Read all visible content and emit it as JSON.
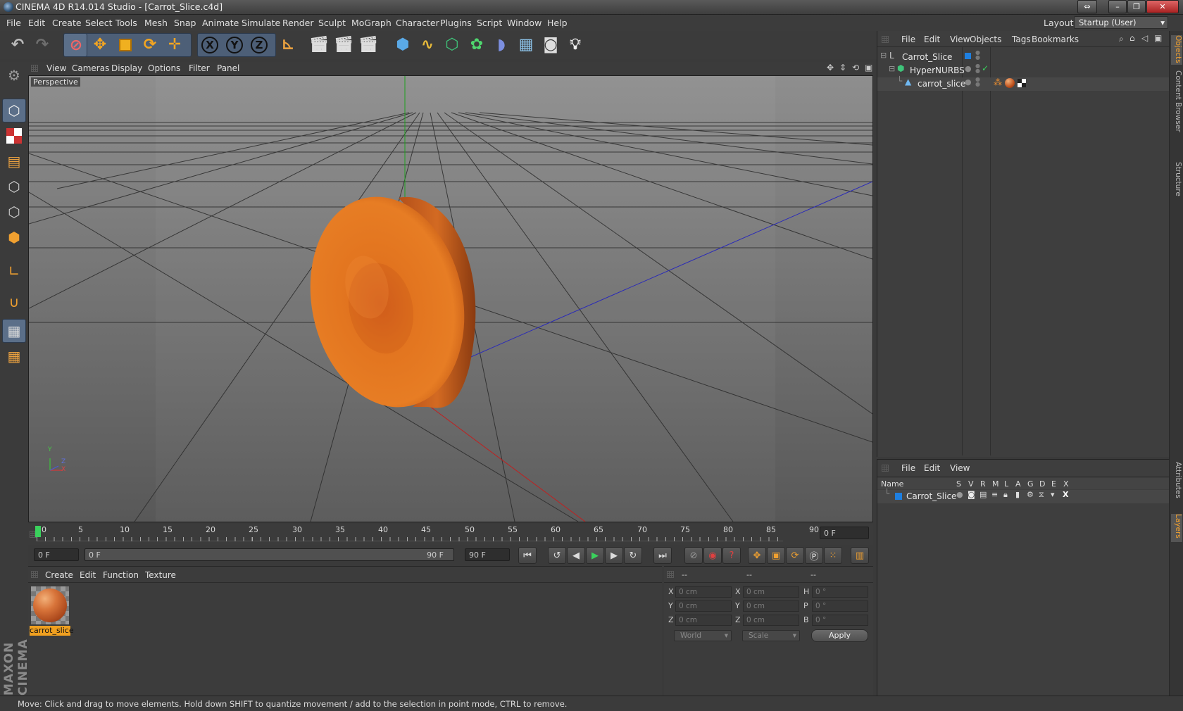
{
  "window": {
    "title": "CINEMA 4D R14.014 Studio - [Carrot_Slice.c4d]"
  },
  "menu": [
    "File",
    "Edit",
    "Create",
    "Select",
    "Tools",
    "Mesh",
    "Snap",
    "Animate",
    "Simulate",
    "Render",
    "Sculpt",
    "MoGraph",
    "Character",
    "Plugins",
    "Script",
    "Window",
    "Help"
  ],
  "layout": {
    "label": "Layout:",
    "value": "Startup (User)"
  },
  "viewport": {
    "menu": [
      "View",
      "Cameras",
      "Display",
      "Options",
      "Filter",
      "Panel"
    ],
    "label": "Perspective",
    "axes": {
      "y": "Y",
      "x": "X",
      "z": "Z"
    }
  },
  "timeline": {
    "ticks": [
      "0",
      "5",
      "10",
      "15",
      "20",
      "25",
      "30",
      "35",
      "40",
      "45",
      "50",
      "55",
      "60",
      "65",
      "70",
      "75",
      "80",
      "85",
      "90"
    ],
    "current": "0 F"
  },
  "transport": {
    "start": "0 F",
    "range_start": "0 F",
    "range_end": "90 F",
    "end": "90 F"
  },
  "material_panel": {
    "menu": [
      "Create",
      "Edit",
      "Function",
      "Texture"
    ],
    "material_name": "carrot_slice"
  },
  "coord_panel": {
    "headers": [
      "--",
      "--",
      "--"
    ],
    "rows": [
      {
        "a": "X",
        "av": "0 cm",
        "b": "X",
        "bv": "0 cm",
        "c": "H",
        "cv": "0 °"
      },
      {
        "a": "Y",
        "av": "0 cm",
        "b": "Y",
        "bv": "0 cm",
        "c": "P",
        "cv": "0 °"
      },
      {
        "a": "Z",
        "av": "0 cm",
        "b": "Z",
        "bv": "0 cm",
        "c": "B",
        "cv": "0 °"
      }
    ],
    "space": "World",
    "mode": "Scale",
    "apply": "Apply"
  },
  "object_manager": {
    "menu": [
      "File",
      "Edit",
      "View",
      "Objects",
      "Tags",
      "Bookmarks"
    ],
    "objects": [
      "Carrot_Slice",
      "HyperNURBS",
      "carrot_slice"
    ]
  },
  "layer_manager": {
    "menu": [
      "File",
      "Edit",
      "View"
    ],
    "headers": [
      "Name",
      "S",
      "V",
      "R",
      "M",
      "L",
      "A",
      "G",
      "D",
      "E",
      "X"
    ],
    "layers": [
      "Carrot_Slice"
    ]
  },
  "side_tabs": [
    "Objects",
    "Content Browser",
    "Structure",
    "Attributes",
    "Layers"
  ],
  "branding": "MAXON CINEMA 4D",
  "status": "Move: Click and drag to move elements. Hold down SHIFT to quantize movement / add to the selection in point mode, CTRL to remove."
}
